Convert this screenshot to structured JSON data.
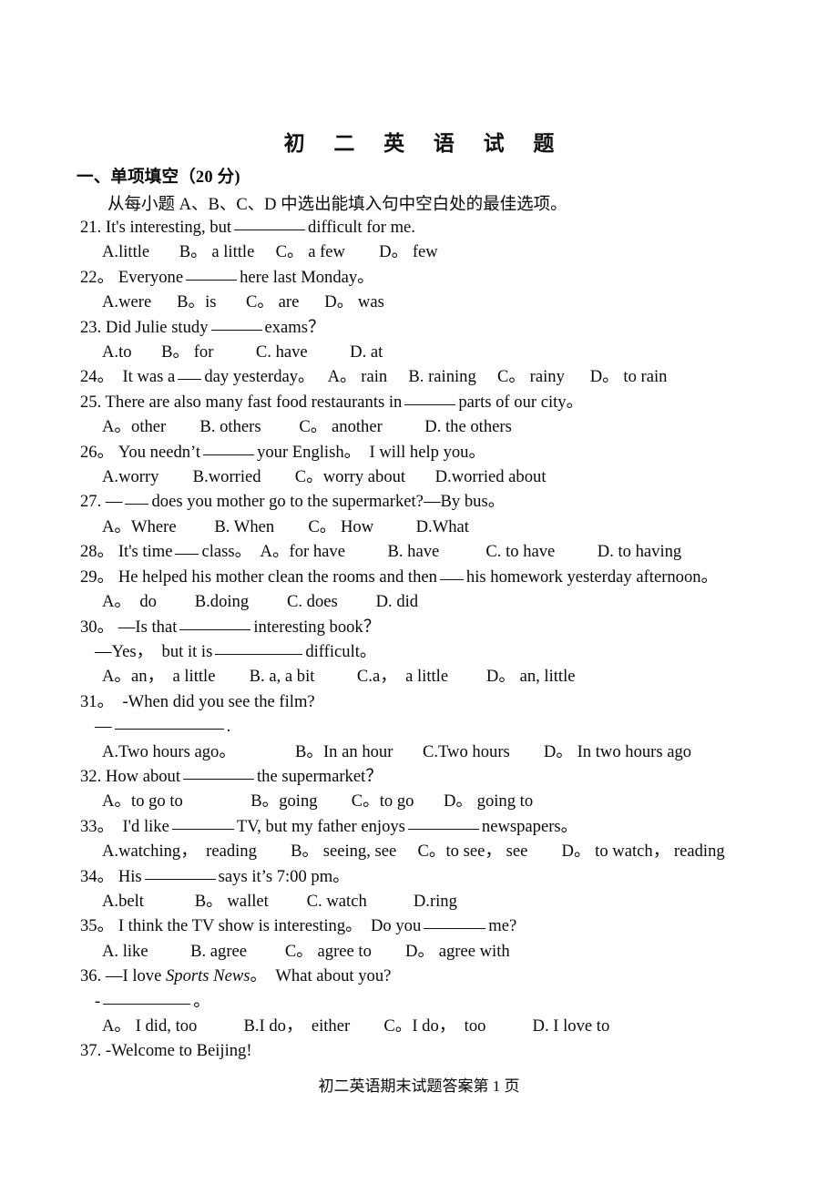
{
  "document": {
    "title": "初  二  英  语  试  题",
    "footer": "初二英语期末试题答案第 1 页"
  },
  "section": {
    "heading": "一、单项填空（20 分)",
    "instruction": "从每小题 A、B、C、D 中选出能填入句中空白处的最佳选项。"
  },
  "questions": {
    "q21_stem_a": "21. It's interesting, but",
    "q21_stem_b": "difficult for me.",
    "q21_options": "A.little       B。 a little     C。 a few        D。 few",
    "q22_stem_a": "22。 Everyone",
    "q22_stem_b": "here last Monday。",
    "q22_options": "A.were      B。is       C。 are      D。 was",
    "q23_stem_a": "23. Did Julie study",
    "q23_stem_b": "exams？",
    "q23_options": "A.to       B。 for          C. have          D. at",
    "q24_stem_a": "24。  It was a",
    "q24_stem_b": "day yesterday。   A。 rain     B. raining     C。 rainy      D。 to rain",
    "q25_stem_a": "25. There are also many fast food restaurants in",
    "q25_stem_b": "parts of our city。",
    "q25_options": "A。other        B. others         C。 another          D. the others",
    "q26_stem_a": "26。 You needn’t",
    "q26_stem_b": "your English。  I will help you。",
    "q26_options": "A.worry        B.worried        C。worry about       D.worried about",
    "q27_stem_a": "27. —",
    "q27_stem_b": "does you mother go to the supermarket?—By bus。",
    "q27_options": "A。Where         B. When        C。 How          D.What",
    "q28_stem_a": "28。 It's time",
    "q28_stem_b": "class。  A。for have          B. have           C. to have          D. to having",
    "q29_stem_a": "29。 He helped his mother clean the rooms and then",
    "q29_stem_b": "his homework yesterday afternoon。",
    "q29_options": "A。  do         B.doing         C. does         D. did",
    "q30_stem_a": "30。 —Is that",
    "q30_stem_b": "interesting book？",
    "q30_sub_a": "—Yes，  but it is",
    "q30_sub_b": "difficult。",
    "q30_options": "A。an，  a little        B. a, a bit          C.a，  a little         D。 an, little",
    "q31_stem": "31。  -When did you see the film?",
    "q31_answer_a": "—",
    "q31_answer_b": ".",
    "q31_options": "A.Two hours ago。              B。In an hour       C.Two hours        D。 In two hours ago",
    "q32_stem_a": "32. How about",
    "q32_stem_b": "the supermarket？",
    "q32_options": "A。to go to                B。going        C。to go       D。 going to",
    "q33_stem_a": "33。  I'd like",
    "q33_stem_b": "TV, but my father enjoys",
    "q33_stem_c": "newspapers。",
    "q33_options": "A.watching，  reading        B。 seeing, see     C。to see， see        D。 to watch， reading",
    "q34_stem_a": "34。 His",
    "q34_stem_b": "says it’s 7:00 pm。",
    "q34_options": "A.belt            B。 wallet         C. watch           D.ring",
    "q35_stem_a": "35。 I think the TV show is interesting。  Do you",
    "q35_stem_b": "me?",
    "q35_options": "A. like          B. agree         C。 agree to        D。 agree with",
    "q36_stem_a": "36. —I love ",
    "q36_stem_italic": "Sports News",
    "q36_stem_b": "。  What about you?",
    "q36_answer_a": "-",
    "q36_answer_b": "。",
    "q36_options": "A。 I did, too           B.I do，  either        C。I do，  too           D. I love to",
    "q37_stem": "37. -Welcome to Beijing!"
  }
}
